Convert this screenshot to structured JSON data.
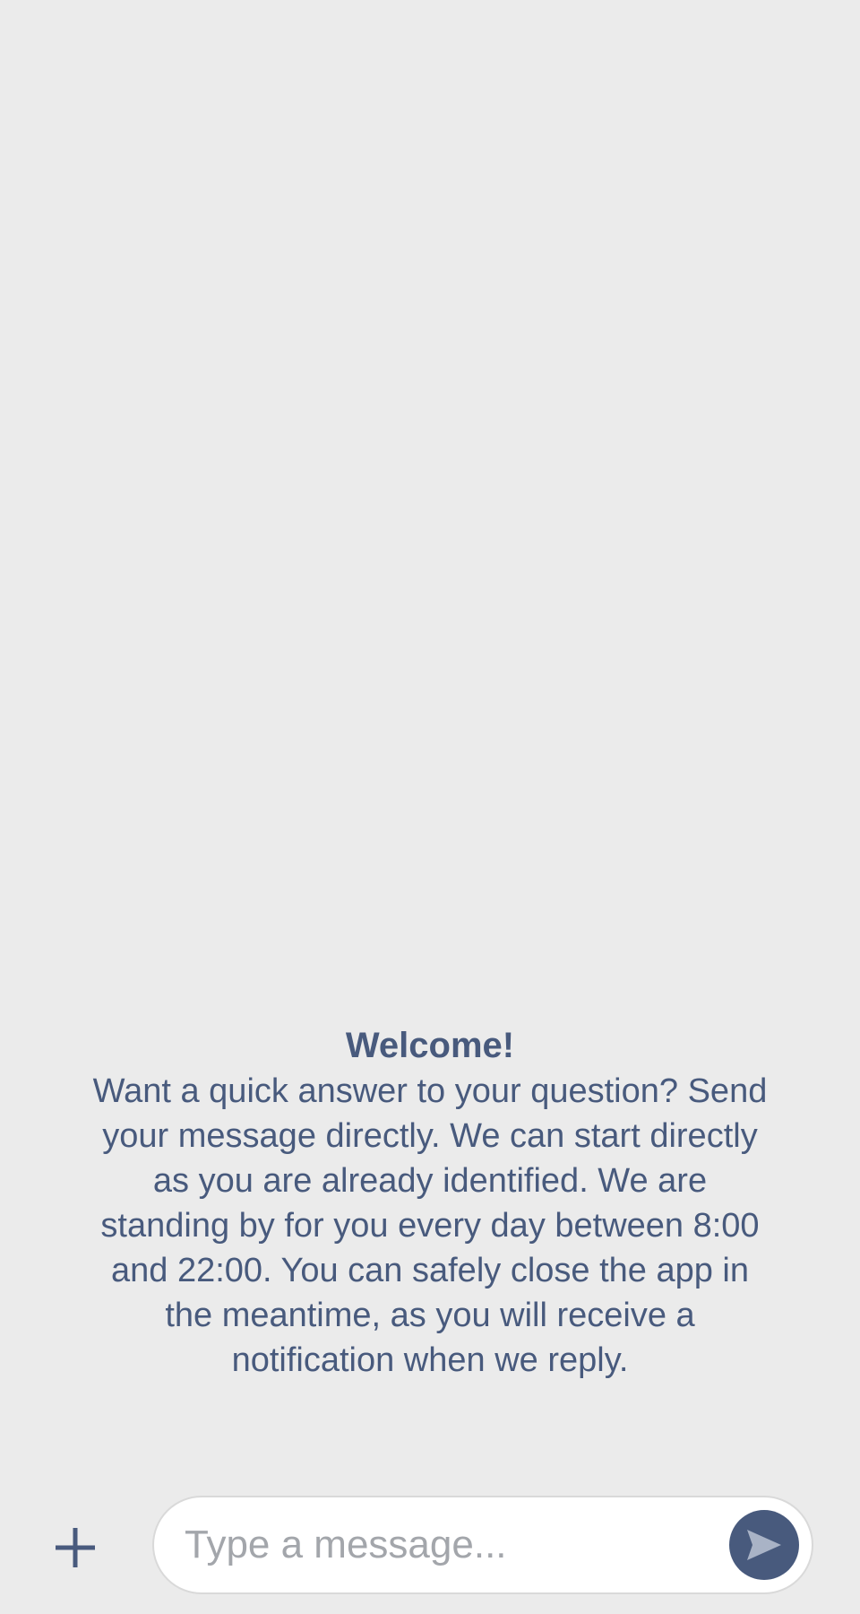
{
  "welcome": {
    "title": "Welcome!",
    "body": "Want a quick answer to your question? Send your message directly. We can start directly as you are already identified. We are standing by for you every day between 8:00 and 22:00. You can safely close the app in the meantime, as you will receive a notification when we reply."
  },
  "composer": {
    "placeholder": "Type a message...",
    "value": "",
    "add_icon": "plus-icon",
    "send_icon": "send-icon"
  },
  "colors": {
    "background": "#ebebeb",
    "accent": "#485a7d",
    "placeholder": "#a3a6ab",
    "input_background": "#ffffff"
  }
}
